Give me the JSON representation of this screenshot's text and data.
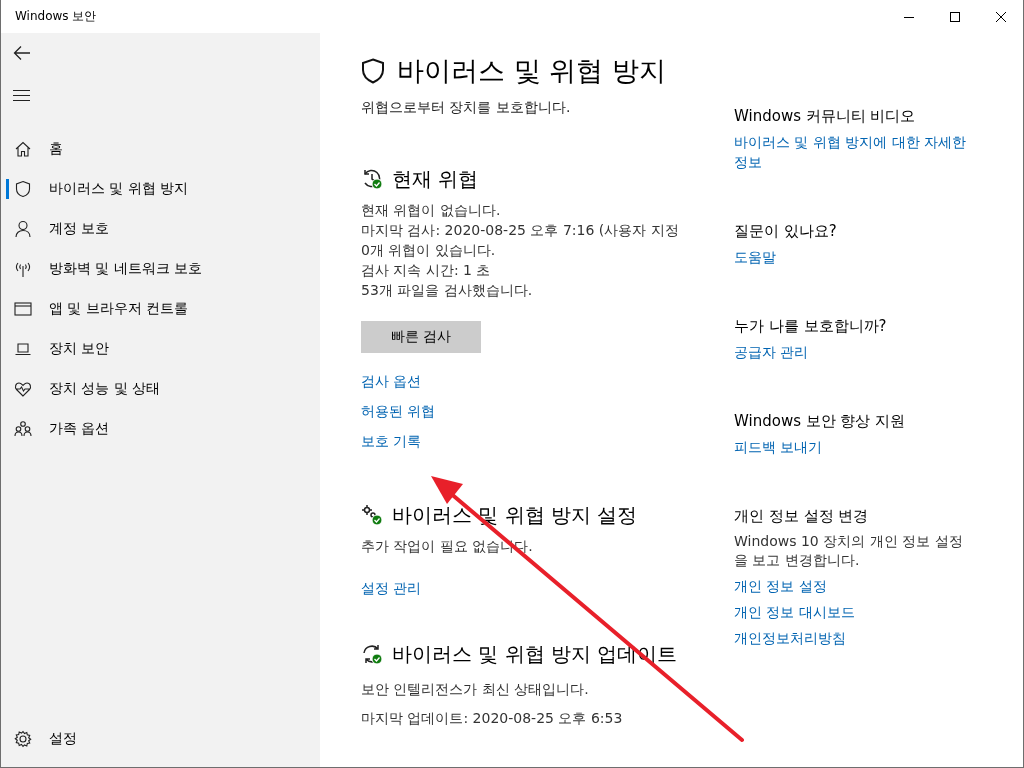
{
  "window": {
    "title": "Windows 보안"
  },
  "sidebar": {
    "items": [
      {
        "label": "홈",
        "selected": false
      },
      {
        "label": "바이러스 및 위협 방지",
        "selected": true
      },
      {
        "label": "계정 보호",
        "selected": false
      },
      {
        "label": "방화벽 및 네트워크 보호",
        "selected": false
      },
      {
        "label": "앱 및 브라우저 컨트롤",
        "selected": false
      },
      {
        "label": "장치 보안",
        "selected": false
      },
      {
        "label": "장치 성능 및 상태",
        "selected": false
      },
      {
        "label": "가족 옵션",
        "selected": false
      }
    ],
    "settings": "설정"
  },
  "main": {
    "title": "바이러스 및 위협 방지",
    "subtitle": "위협으로부터 장치를 보호합니다.",
    "sections": [
      {
        "kind": "threats",
        "heading": "현재 위협",
        "lines": [
          "현재 위협이 없습니다.",
          "마지막 검사: 2020-08-25 오후 7:16 (사용자 지정",
          "0개 위협이 있습니다.",
          "검사 지속 시간: 1 초",
          "53개 파일을 검사했습니다."
        ],
        "button": "빠른 검사",
        "links": [
          "검사 옵션",
          "허용된 위협",
          "보호 기록"
        ]
      },
      {
        "kind": "settings",
        "heading": "바이러스 및 위협 방지 설정",
        "lines": [
          "추가 작업이 필요 없습니다."
        ],
        "links": [
          "설정 관리"
        ]
      },
      {
        "kind": "updates",
        "heading": "바이러스 및 위협 방지 업데이트",
        "lines": [
          "보안 인텔리전스가 최신 상태입니다.",
          "마지막 업데이트: 2020-08-25 오후 6:53"
        ]
      }
    ]
  },
  "aside": [
    {
      "heading": "Windows 커뮤니티 비디오",
      "links": [
        "바이러스 및 위협 방지에 대한 자세한 정보"
      ]
    },
    {
      "heading": "질문이 있나요?",
      "links": [
        "도움말"
      ]
    },
    {
      "heading": "누가 나를 보호합니까?",
      "links": [
        "공급자 관리"
      ]
    },
    {
      "heading": "Windows 보안 향상 지원",
      "links": [
        "피드백 보내기"
      ]
    },
    {
      "heading": "개인 정보 설정 변경",
      "description": "Windows 10 장치의 개인 정보 설정을 보고 변경합니다.",
      "links": [
        "개인 정보 설정",
        "개인 정보 대시보드",
        "개인정보처리방침"
      ]
    }
  ]
}
